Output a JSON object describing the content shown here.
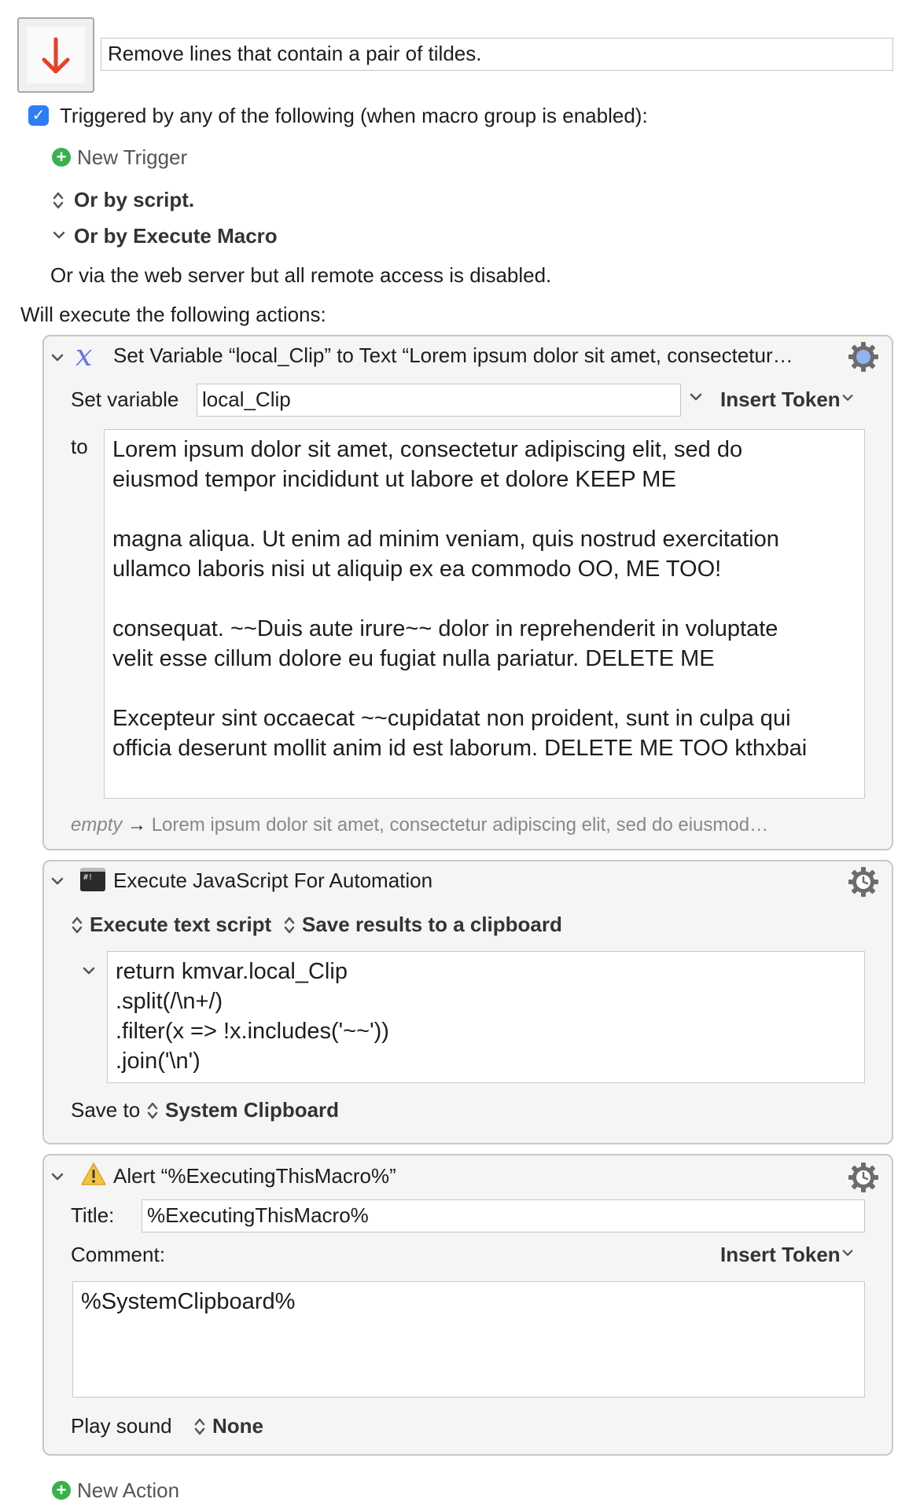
{
  "macro": {
    "title": "Remove lines that contain a pair of tildes.",
    "triggered_label": "Triggered by any of the following (when macro group is enabled):",
    "new_trigger": "New Trigger",
    "or_by_script": "Or by script.",
    "or_by_execute_macro": "Or by Execute Macro",
    "web_server_note": "Or via the web server but all remote access is disabled.",
    "will_execute": "Will execute the following actions:",
    "new_action": "New Action"
  },
  "action1": {
    "header": "Set Variable “local_Clip” to Text “Lorem ipsum dolor sit amet, consectetur…",
    "set_variable_label": "Set variable",
    "variable_name": "local_Clip",
    "insert_token": "Insert Token",
    "to_label": "to",
    "text_value": "Lorem ipsum dolor sit amet, consectetur adipiscing elit, sed do\neiusmod tempor incididunt ut labore et dolore KEEP ME\n\nmagna aliqua. Ut enim ad minim veniam, quis nostrud exercitation\nullamco laboris nisi ut aliquip ex ea commodo OO, ME TOO!\n\nconsequat. ~~Duis aute irure~~ dolor in reprehenderit in voluptate\nvelit esse cillum dolore eu fugiat nulla pariatur. DELETE ME\n\nExcepteur sint occaecat ~~cupidatat non proident, sunt in culpa qui\nofficia deserunt mollit anim id est laborum. DELETE ME TOO kthxbai",
    "preview_empty": "empty",
    "preview_arrow": "→",
    "preview_text": "Lorem ipsum dolor sit amet, consectetur adipiscing elit, sed do eiusmod…"
  },
  "action2": {
    "header": "Execute JavaScript For Automation",
    "execute_mode": "Execute text script",
    "save_results": "Save results to a clipboard",
    "script": "return kmvar.local_Clip\n.split(/\\n+/)\n.filter(x => !x.includes('~~'))\n.join('\\n')",
    "save_to_label": "Save to",
    "save_to_value": "System Clipboard"
  },
  "action3": {
    "header": "Alert “%ExecutingThisMacro%”",
    "title_label": "Title:",
    "title_value": "%ExecutingThisMacro%",
    "comment_label": "Comment:",
    "insert_token": "Insert Token",
    "comment_value": "%SystemClipboard%",
    "play_sound_label": "Play sound",
    "play_sound_value": "None"
  },
  "colors": {
    "accent_blue": "#2f7df6",
    "add_green": "#37b24d",
    "trigger_arrow_red": "#e5412b"
  }
}
